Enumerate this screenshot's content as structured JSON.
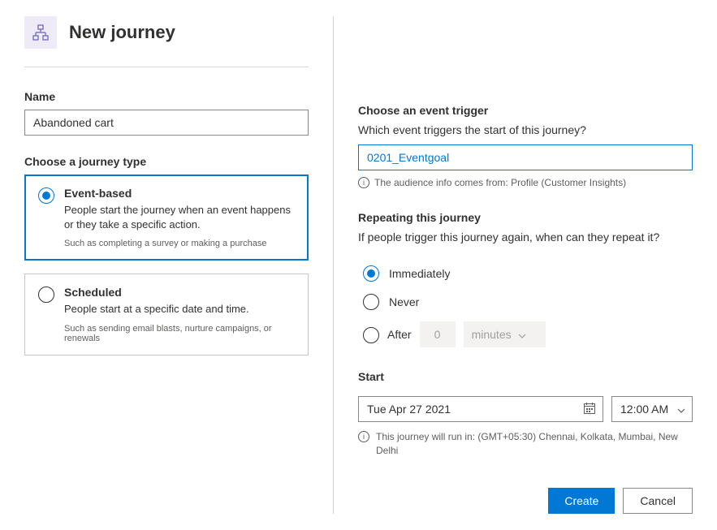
{
  "header": {
    "title": "New journey"
  },
  "name_section": {
    "label": "Name",
    "value": "Abandoned cart"
  },
  "journey_type": {
    "label": "Choose a journey type",
    "options": [
      {
        "title": "Event-based",
        "desc": "People start the journey when an event happens or they take a specific action.",
        "hint": "Such as completing a survey or making a purchase"
      },
      {
        "title": "Scheduled",
        "desc": "People start at a specific date and time.",
        "hint": "Such as sending email blasts, nurture campaigns, or renewals"
      }
    ]
  },
  "event_trigger": {
    "label": "Choose an event trigger",
    "question": "Which event triggers the start of this journey?",
    "value": "0201_Eventgoal",
    "info": "The audience info comes from: Profile (Customer Insights)"
  },
  "repeating": {
    "label": "Repeating this journey",
    "question": "If people trigger this journey again, when can they repeat it?",
    "options": {
      "immediately": "Immediately",
      "never": "Never",
      "after": "After",
      "after_value": "0",
      "after_unit": "minutes"
    }
  },
  "start": {
    "label": "Start",
    "date": "Tue Apr 27 2021",
    "time": "12:00 AM",
    "timezone": "This journey will run in: (GMT+05:30) Chennai, Kolkata, Mumbai, New Delhi"
  },
  "footer": {
    "create": "Create",
    "cancel": "Cancel"
  }
}
